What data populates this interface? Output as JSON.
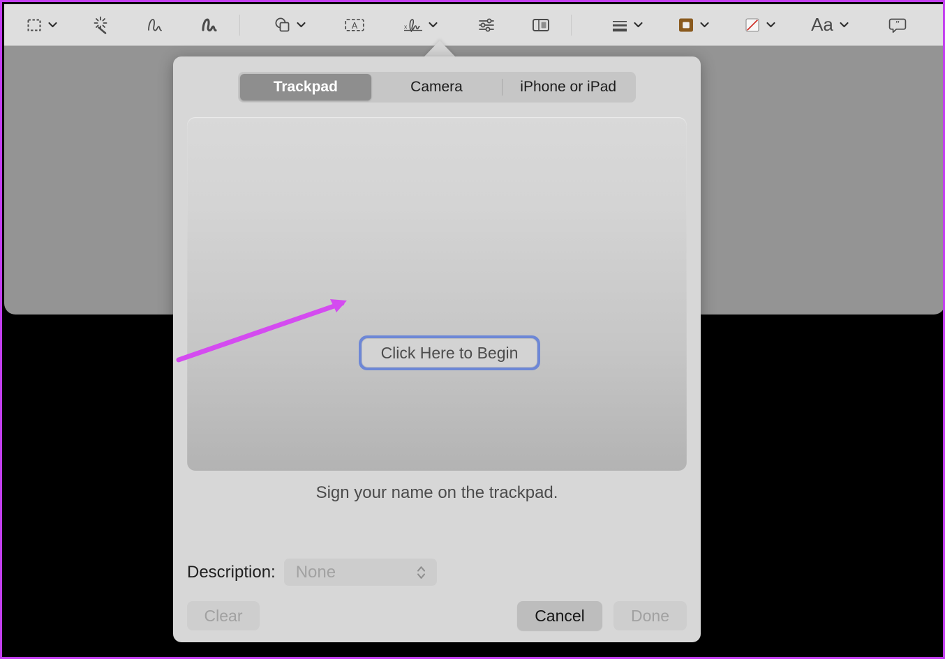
{
  "toolbar": {
    "items": [
      {
        "name": "selection-tool",
        "icon": "dashed-rectangle-selection-icon",
        "has_dropdown": true
      },
      {
        "name": "instant-alpha-tool",
        "icon": "magic-wand-icon",
        "has_dropdown": false
      },
      {
        "name": "sketch-tool",
        "icon": "sketch-squiggle-icon",
        "has_dropdown": false
      },
      {
        "name": "draw-tool",
        "icon": "draw-squiggle-icon",
        "has_dropdown": false
      },
      {
        "name": "shapes-tool",
        "icon": "shapes-icon",
        "has_dropdown": true
      },
      {
        "name": "text-tool",
        "icon": "text-box-icon",
        "has_dropdown": false
      },
      {
        "name": "signature-tool",
        "icon": "signature-icon",
        "has_dropdown": true
      },
      {
        "name": "adjust-color-tool",
        "icon": "sliders-icon",
        "has_dropdown": false
      },
      {
        "name": "adjust-size-tool",
        "icon": "panel-layout-icon",
        "has_dropdown": false
      },
      {
        "name": "shape-style-tool",
        "icon": "line-thickness-icon",
        "has_dropdown": true
      },
      {
        "name": "border-color-tool",
        "icon": "border-color-swatch-icon",
        "has_dropdown": true
      },
      {
        "name": "fill-color-tool",
        "icon": "fill-color-none-icon",
        "has_dropdown": true
      },
      {
        "name": "text-style-tool",
        "icon": "font-aa-icon",
        "has_dropdown": true
      },
      {
        "name": "annotate-tool",
        "icon": "comment-bubble-icon",
        "has_dropdown": false
      }
    ],
    "text_style_label": "Aa",
    "colors": {
      "border_swatch": "#8a5a1e",
      "fill_none_slash": "#d0322b",
      "icon_stroke": "#4a4a4a"
    }
  },
  "popover": {
    "segmented_control": {
      "tabs": [
        {
          "label": "Trackpad",
          "selected": true
        },
        {
          "label": "Camera",
          "selected": false
        },
        {
          "label": "iPhone or iPad",
          "selected": false
        }
      ]
    },
    "trackpad": {
      "begin_button_label": "Click Here to Begin",
      "focus_ring_color": "#6d87d6",
      "hint_text": "Sign your name on the trackpad."
    },
    "description": {
      "label": "Description:",
      "value": "None",
      "options": [
        "None"
      ],
      "enabled": false,
      "stepper_icon": "chevron-up-down-icon"
    },
    "buttons": {
      "clear": {
        "label": "Clear",
        "enabled": false
      },
      "cancel": {
        "label": "Cancel",
        "enabled": true
      },
      "done": {
        "label": "Done",
        "enabled": false
      }
    }
  },
  "annotation": {
    "arrow_color": "#d44bf0",
    "points_to": "Click Here to Begin"
  },
  "canvas": {
    "document_color": "#949494",
    "backdrop_color": "#000000",
    "frame_border_color": "#c33ff0"
  }
}
